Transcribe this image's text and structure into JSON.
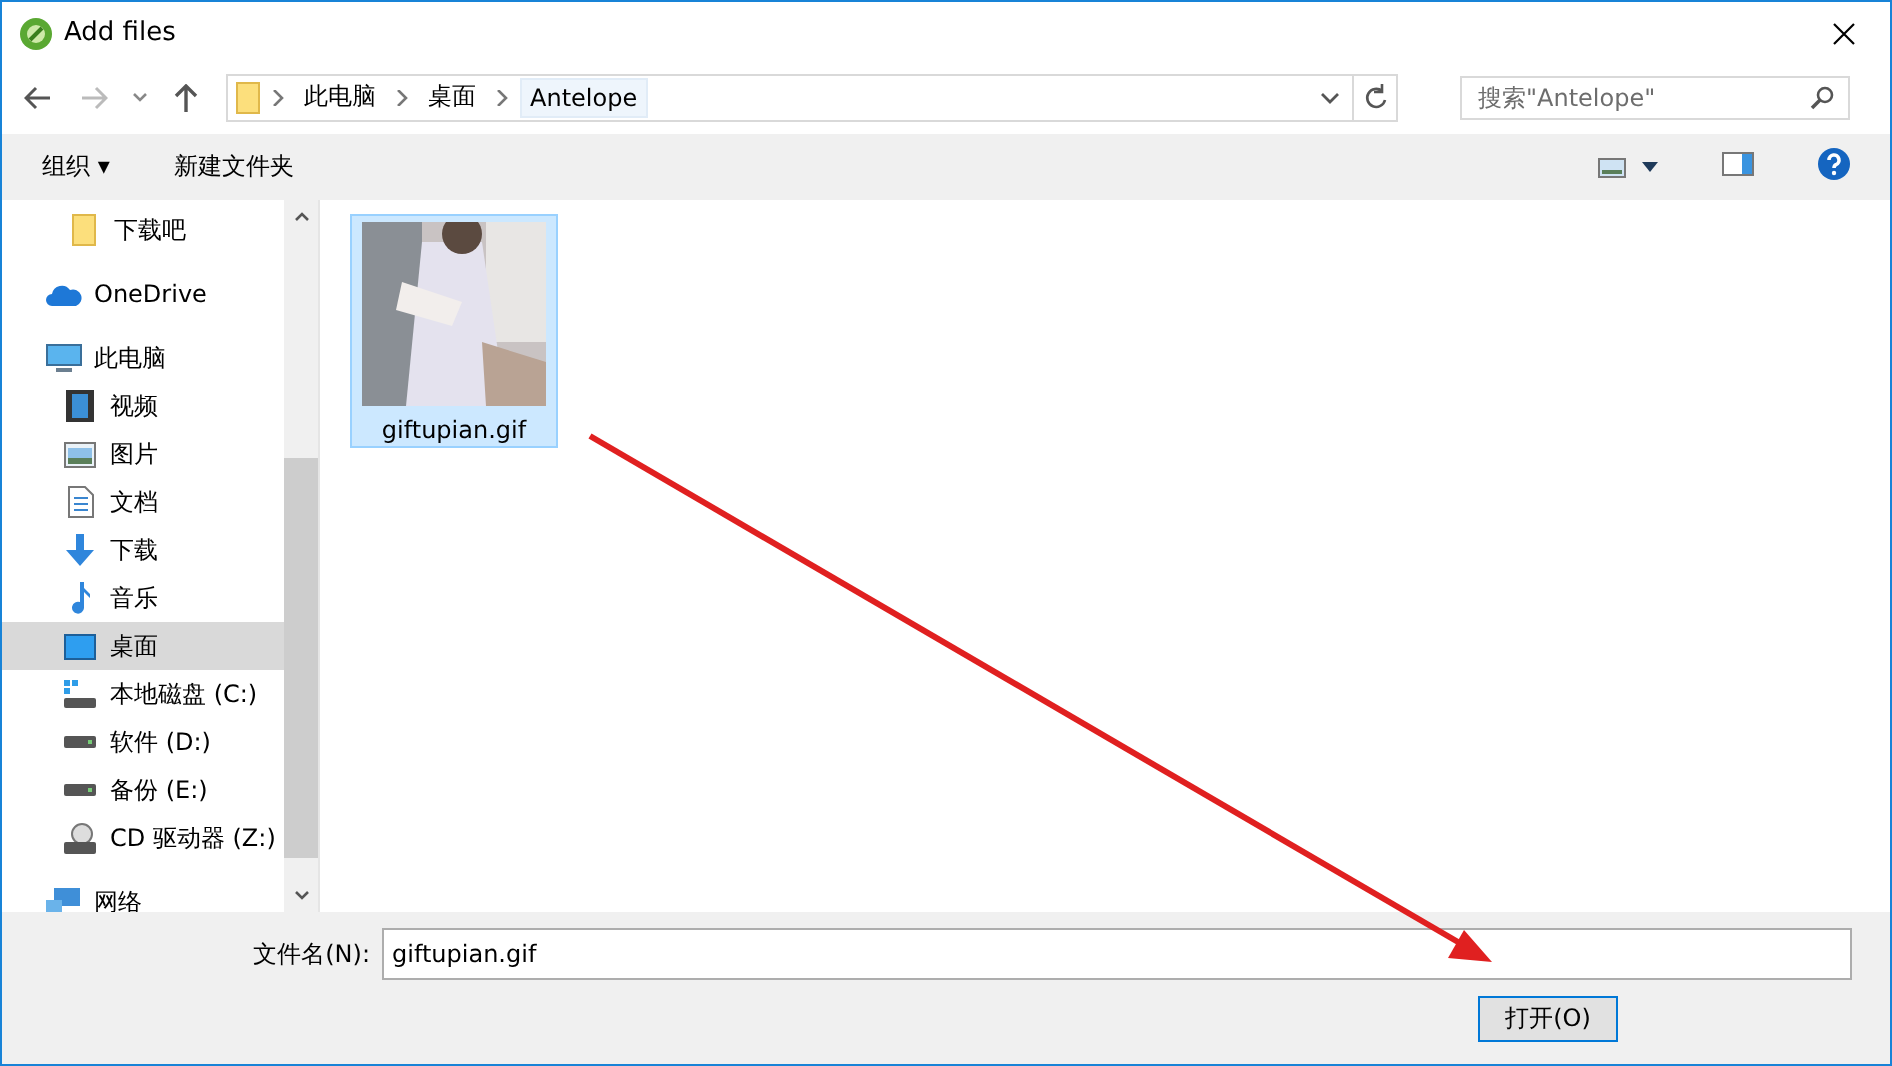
{
  "window": {
    "title": "Add files"
  },
  "address_bar": {
    "path": [
      "此电脑",
      "桌面",
      "Antelope"
    ]
  },
  "search": {
    "placeholder": "搜索\"Antelope\""
  },
  "toolbar": {
    "organize": "组织 ▾",
    "new_folder": "新建文件夹"
  },
  "sidebar": {
    "scrolled_parent_children": [
      {
        "label": "下载吧",
        "kind": "folder",
        "selected": false
      }
    ],
    "items": [
      {
        "label": "OneDrive",
        "kind": "cloud",
        "selected": false
      },
      {
        "label": "此电脑",
        "kind": "pc",
        "selected": false,
        "children": [
          {
            "label": "视频",
            "kind": "video",
            "selected": false
          },
          {
            "label": "图片",
            "kind": "pictures",
            "selected": false
          },
          {
            "label": "文档",
            "kind": "docs",
            "selected": false
          },
          {
            "label": "下载",
            "kind": "download",
            "selected": false
          },
          {
            "label": "音乐",
            "kind": "music",
            "selected": false
          },
          {
            "label": "桌面",
            "kind": "desktop",
            "selected": true
          },
          {
            "label": "本地磁盘 (C:)",
            "kind": "sysdrive",
            "selected": false
          },
          {
            "label": "软件 (D:)",
            "kind": "drive",
            "selected": false
          },
          {
            "label": "备份 (E:)",
            "kind": "drive",
            "selected": false
          },
          {
            "label": "CD 驱动器 (Z:)",
            "kind": "cd",
            "selected": false
          }
        ]
      },
      {
        "label": "网络",
        "kind": "network",
        "selected": false
      }
    ]
  },
  "files": [
    {
      "name": "giftupian.gif",
      "selected": true,
      "kind": "picture"
    }
  ],
  "footer": {
    "filename_label": "文件名(N):",
    "filename": "giftupian.gif",
    "open_button": "打开(O)"
  }
}
